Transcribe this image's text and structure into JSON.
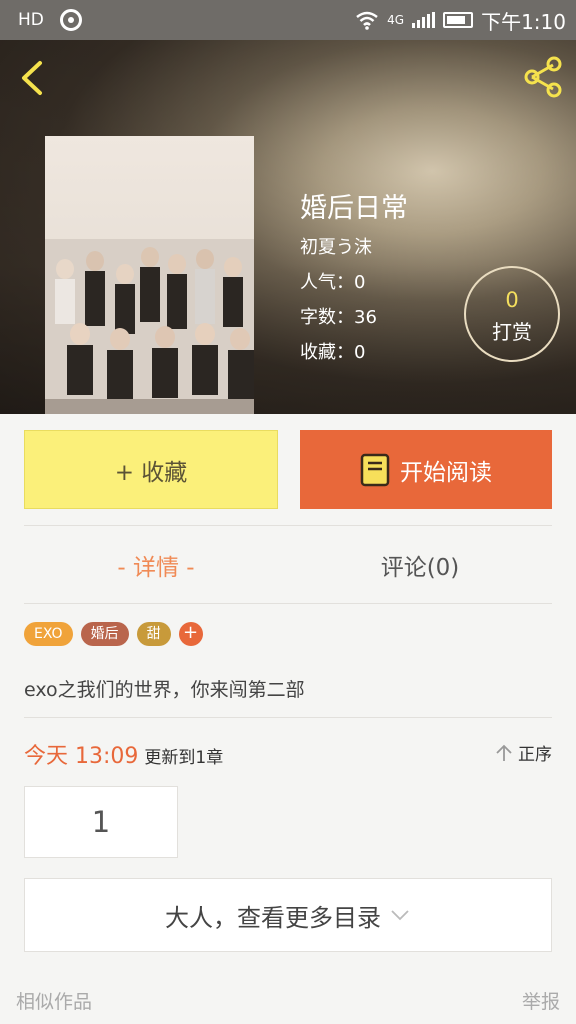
{
  "status_bar": {
    "hd": "HD",
    "network": "4G",
    "time": "下午1:10"
  },
  "book": {
    "title": "婚后日常",
    "author": "初夏う沫",
    "popularity": "人气：0",
    "word_count": "字数：36",
    "favorites": "收藏：0"
  },
  "tip": {
    "count": "0",
    "label": "打赏"
  },
  "actions": {
    "collect_label": "+ 收藏",
    "read_label": "开始阅读"
  },
  "tabs": {
    "detail": "- 详情 -",
    "comments": "评论(0)"
  },
  "tags": [
    {
      "label": "EXO",
      "color": "#f0a33a"
    },
    {
      "label": "婚后",
      "color": "#b9654c"
    },
    {
      "label": "甜",
      "color": "#c89a3a"
    }
  ],
  "tag_add": "+",
  "description": "exo之我们的世界，你来闯第二部",
  "update": {
    "time": "今天 13:09",
    "info": "更新到1章",
    "order_label": "正序"
  },
  "chapter": "1",
  "more_catalog": "大人，查看更多目录",
  "footer": {
    "similar": "相似作品",
    "report": "举报"
  },
  "colors": {
    "accent_orange": "#e8683a",
    "collect_yellow": "#fbf07a",
    "tip_gold": "#f4df5e"
  }
}
